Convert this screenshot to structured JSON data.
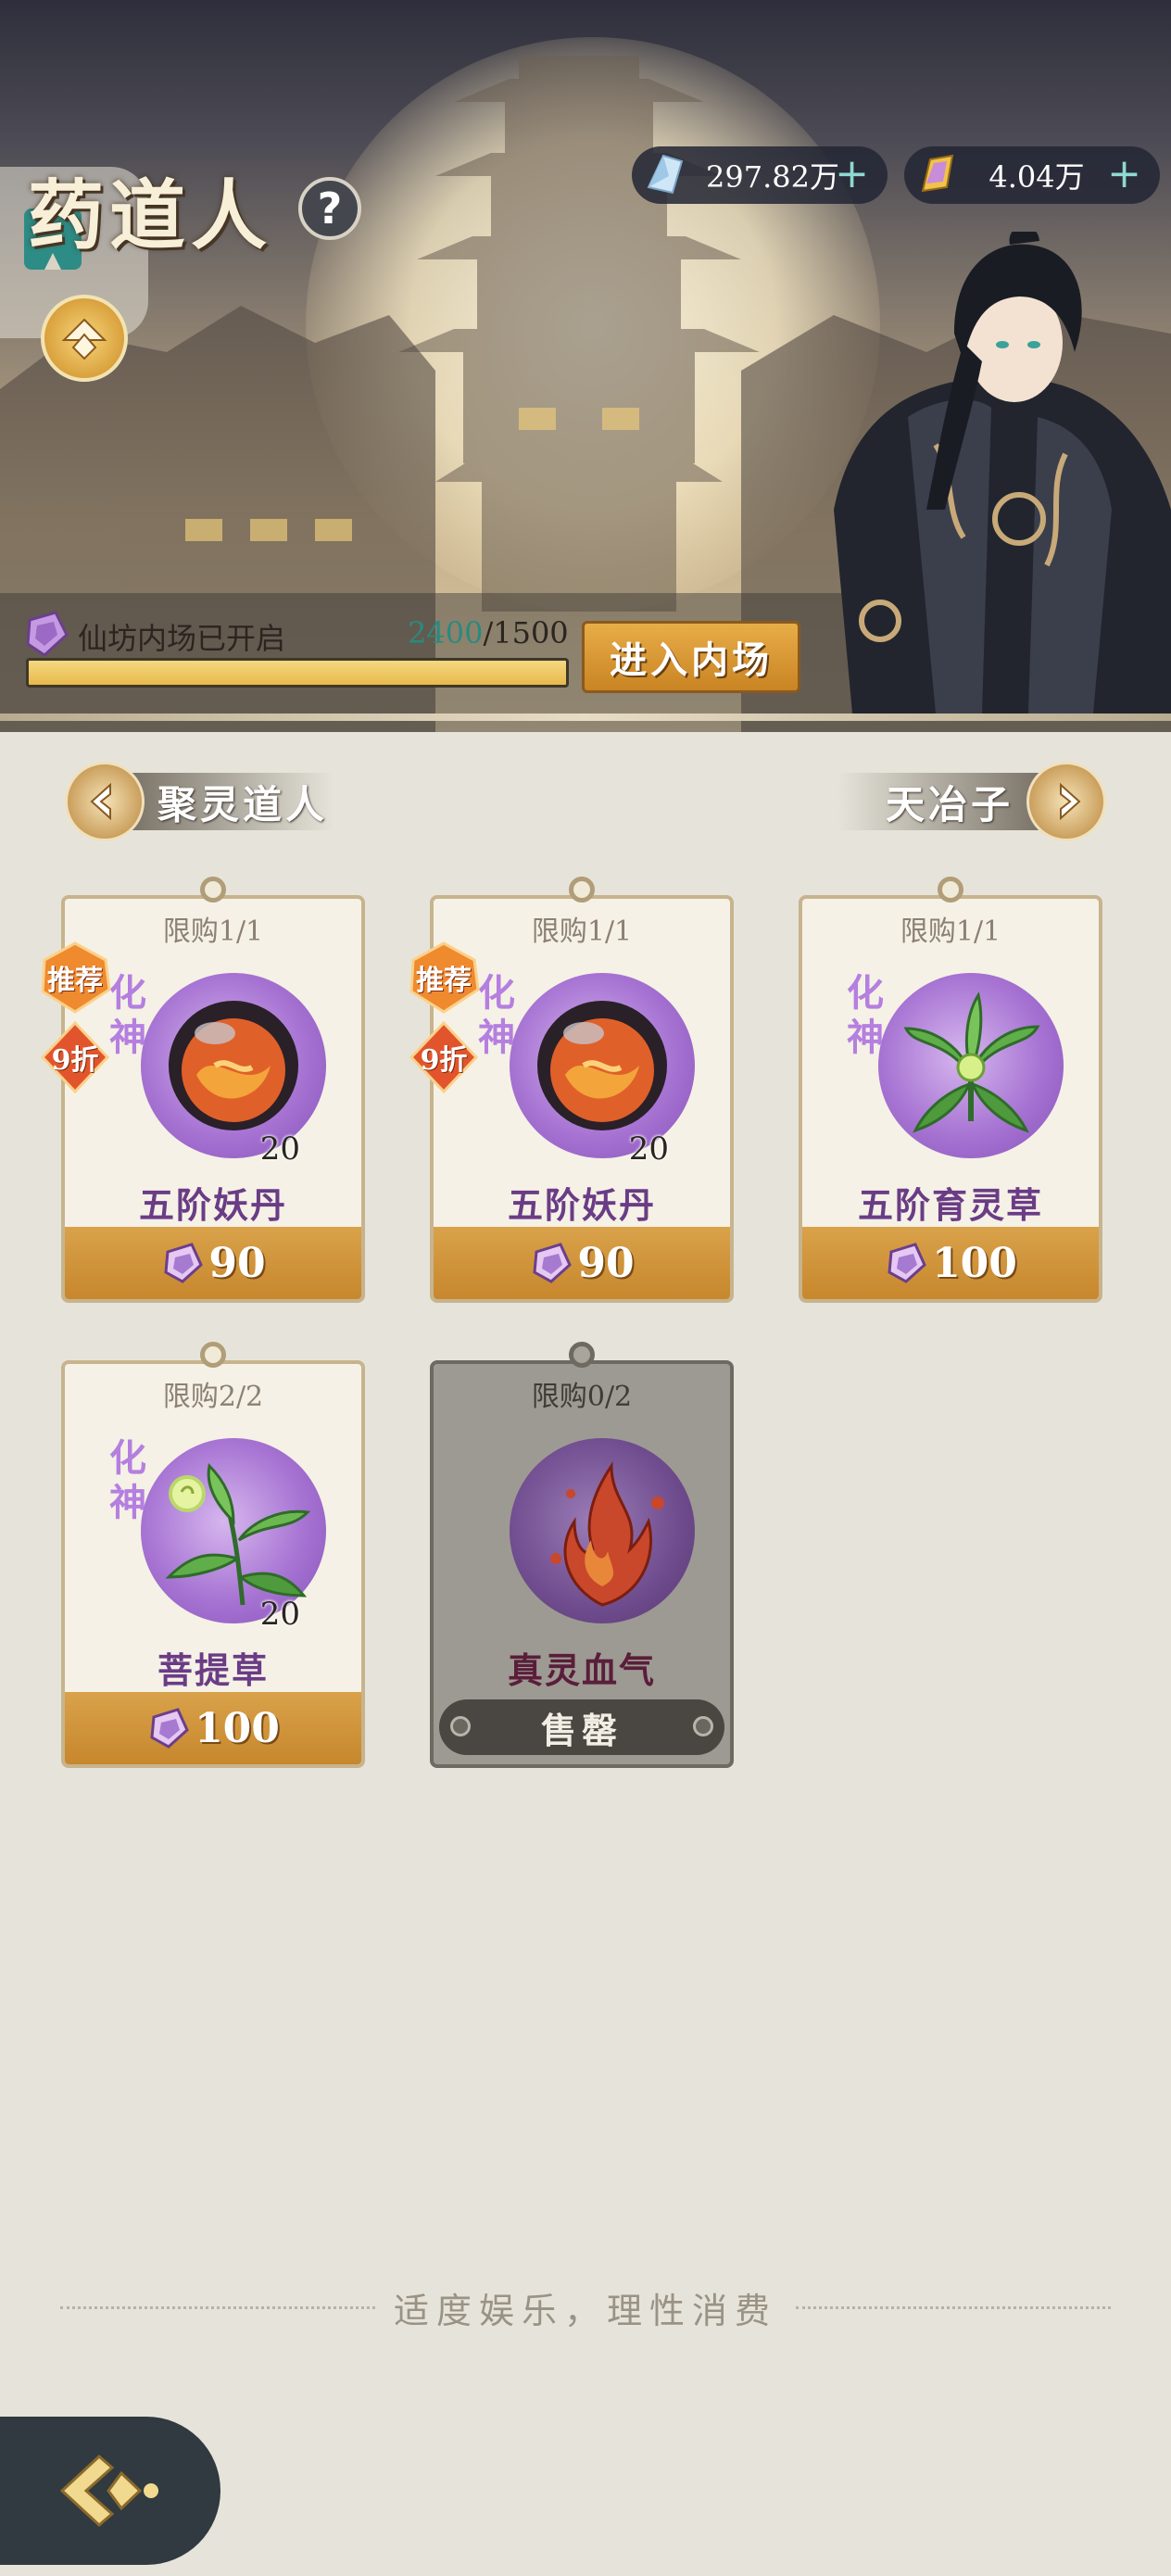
{
  "header": {
    "title": "药道人",
    "help_label": "?",
    "currencies": [
      {
        "icon": "spirit-crystal-icon",
        "value": "297.82万",
        "plus": "+"
      },
      {
        "icon": "gold-ingot-icon",
        "value": "4.04万",
        "plus": "+"
      }
    ]
  },
  "venue": {
    "status_text": "仙坊内场已开启",
    "progress_current": "2400",
    "progress_total": "/1500",
    "progress_fraction": 1.0,
    "enter_label": "进入内场"
  },
  "nav": {
    "prev_label": "聚灵道人",
    "next_label": "天冶子"
  },
  "items": [
    {
      "limit": "限购1/1",
      "grade": "化神",
      "qty": "20",
      "name": "五阶妖丹",
      "price": "90",
      "badge_recommend": "推荐",
      "badge_discount": "9折",
      "art": "demon-core-icon",
      "sold_out": false
    },
    {
      "limit": "限购1/1",
      "grade": "化神",
      "qty": "20",
      "name": "五阶妖丹",
      "price": "90",
      "badge_recommend": "推荐",
      "badge_discount": "9折",
      "art": "demon-core-icon",
      "sold_out": false
    },
    {
      "limit": "限购1/1",
      "grade": "化神",
      "qty": "",
      "name": "五阶育灵草",
      "price": "100",
      "art": "spirit-herb-icon",
      "sold_out": false
    },
    {
      "limit": "限购2/2",
      "grade": "化神",
      "qty": "20",
      "name": "菩提草",
      "price": "100",
      "art": "bodhi-grass-icon",
      "sold_out": false
    },
    {
      "limit": "限购0/2",
      "grade": "",
      "qty": "",
      "name": "真灵血气",
      "sold_out_label": "售罄",
      "art": "blood-flame-icon",
      "sold_out": true
    }
  ],
  "footer": {
    "note": "适度娱乐，理性消费"
  },
  "colors": {
    "accent_gold": "#d9a24a",
    "grade_purple": "#b57fe0",
    "item_name_purple": "#6a3c86",
    "progress_teal": "#2a8a7e"
  }
}
